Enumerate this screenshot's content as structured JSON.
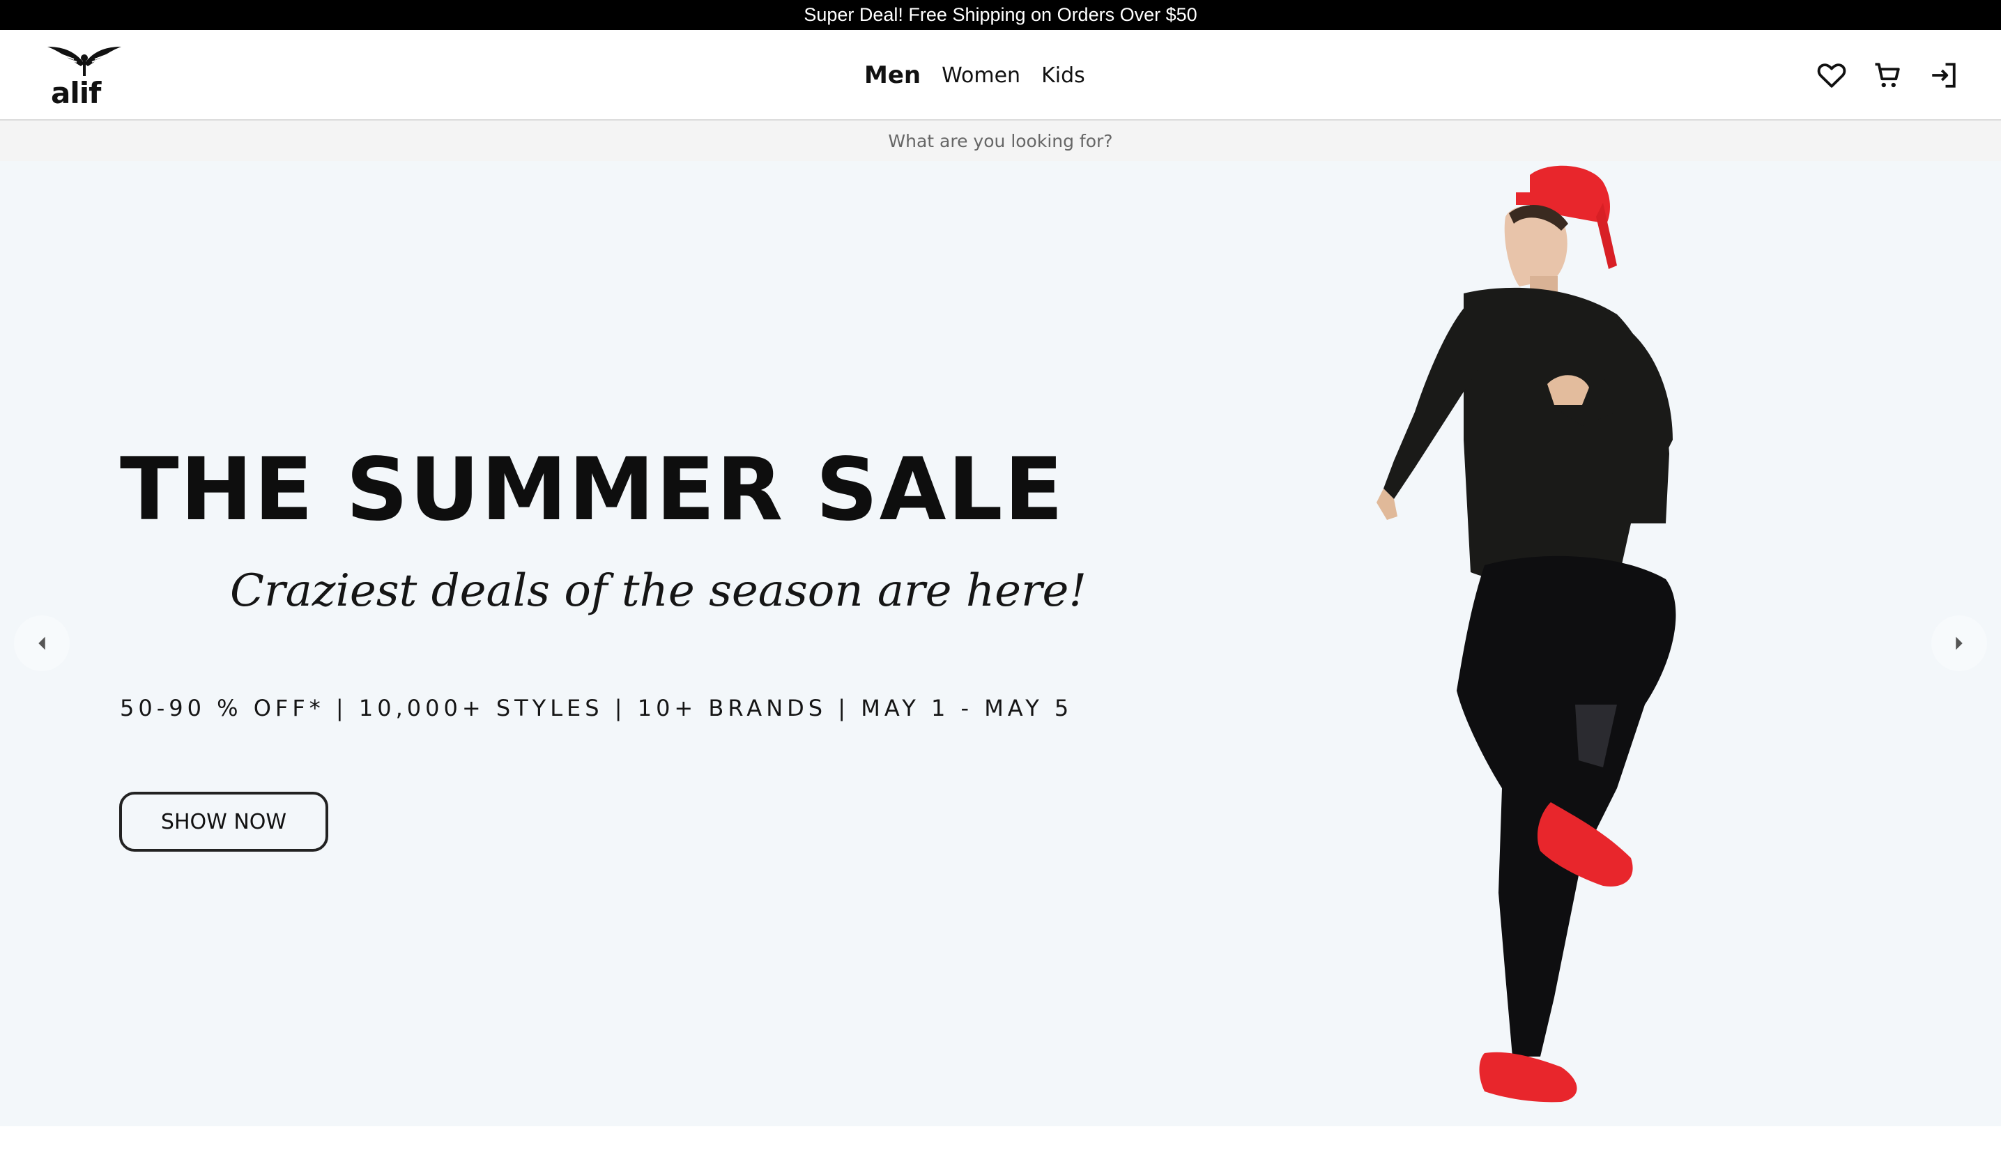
{
  "announcement": "Super Deal! Free Shipping on Orders Over $50",
  "logo": {
    "text": "alif",
    "icon": "winged-logo-icon"
  },
  "nav": {
    "items": [
      {
        "label": "Men",
        "active": true
      },
      {
        "label": "Women",
        "active": false
      },
      {
        "label": "Kids",
        "active": false
      }
    ]
  },
  "header_icons": [
    "heart-icon",
    "cart-icon",
    "login-icon"
  ],
  "search": {
    "placeholder": "What are you looking for?",
    "value": ""
  },
  "hero": {
    "title": "THE SUMMER SALE",
    "subtitle": "Craziest deals of the season are here!",
    "info": "50-90 % OFF* | 10,000+ STYLES | 10+ BRANDS | MAY 1 - MAY 5",
    "button": "SHOW NOW",
    "background": "#f3f7fa",
    "image": "model-in-black-tracksuit-red-cap-red-sneakers"
  },
  "colors": {
    "announce_bg": "#000000",
    "accent_red": "#e8262c",
    "text": "#111111"
  }
}
